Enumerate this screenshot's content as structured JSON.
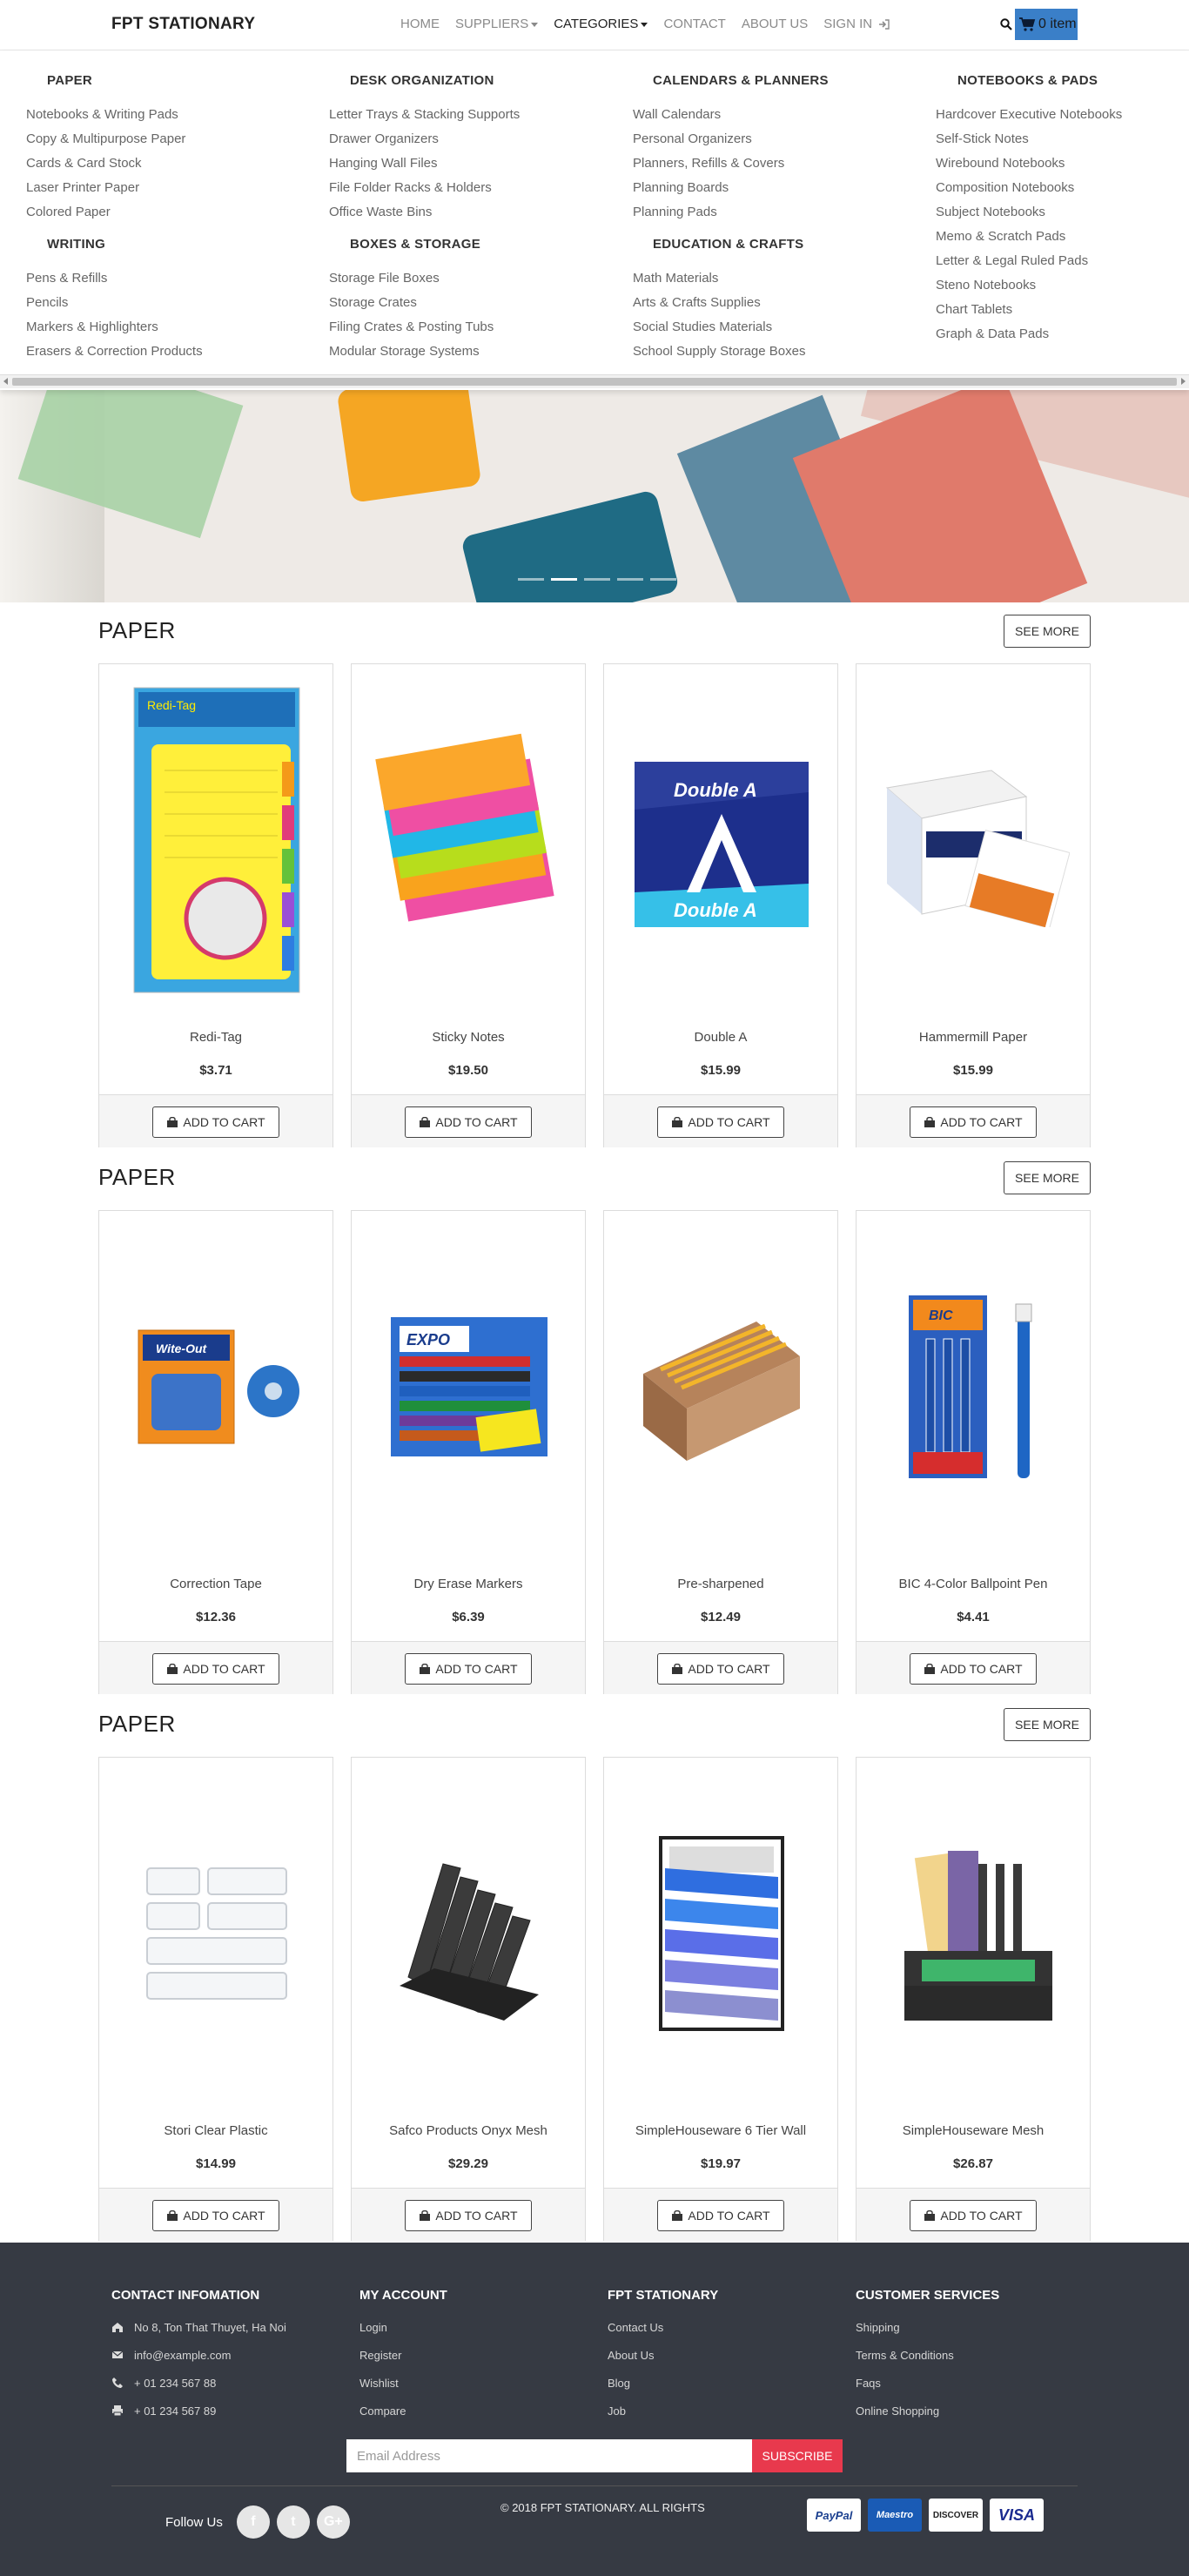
{
  "nav": {
    "brand": "FPT STATIONARY",
    "links": [
      "HOME",
      "SUPPLIERS",
      "CATEGORIES",
      "CONTACT",
      "ABOUT US",
      "SIGN IN"
    ],
    "cart_label": "0 item"
  },
  "mega": {
    "groups": [
      {
        "title": "PAPER",
        "items": [
          "Notebooks & Writing Pads",
          "Copy & Multipurpose Paper",
          "Cards & Card Stock",
          "Laser Printer Paper",
          "Colored Paper"
        ]
      },
      {
        "title": "DESK ORGANIZATION",
        "items": [
          "Letter Trays & Stacking Supports",
          "Drawer Organizers",
          "Hanging Wall Files",
          "File Folder Racks & Holders",
          "Office Waste Bins"
        ]
      },
      {
        "title": "CALENDARS & PLANNERS",
        "items": [
          "Wall Calendars",
          "Personal Organizers",
          "Planners, Refills & Covers",
          "Planning Boards",
          "Planning Pads"
        ]
      },
      {
        "title": "NOTEBOOKS & PADS",
        "items": [
          "Hardcover Executive Notebooks",
          "Self-Stick Notes",
          "Wirebound Notebooks",
          "Composition Notebooks",
          "Subject Notebooks",
          "Memo & Scratch Pads",
          "Letter & Legal Ruled Pads",
          "Steno Notebooks",
          "Chart Tablets",
          "Graph & Data Pads"
        ]
      },
      {
        "title": "WRITING",
        "items": [
          "Pens & Refills",
          "Pencils",
          "Markers & Highlighters",
          "Erasers & Correction Products"
        ]
      },
      {
        "title": "BOXES & STORAGE",
        "items": [
          "Storage File Boxes",
          "Storage Crates",
          "Filing Crates & Posting Tubs",
          "Modular Storage Systems"
        ]
      },
      {
        "title": "EDUCATION & CRAFTS",
        "items": [
          "Math Materials",
          "Arts & Crafts Supplies",
          "Social Studies Materials",
          "School Supply Storage Boxes"
        ]
      }
    ]
  },
  "sections": [
    {
      "title": "PAPER",
      "see_more": "SEE MORE",
      "products": [
        {
          "name": "Redi-Tag",
          "price": "$3.71",
          "icon": "redi-tag-icon"
        },
        {
          "name": "Sticky Notes",
          "price": "$19.50",
          "icon": "sticky-notes-icon"
        },
        {
          "name": "Double A",
          "price": "$15.99",
          "icon": "double-a-paper-icon"
        },
        {
          "name": "Hammermill Paper",
          "price": "$15.99",
          "icon": "hammermill-box-icon"
        }
      ]
    },
    {
      "title": "PAPER",
      "see_more": "SEE MORE",
      "products": [
        {
          "name": "Correction Tape",
          "price": "$12.36",
          "icon": "correction-tape-icon"
        },
        {
          "name": "Dry Erase Markers",
          "price": "$6.39",
          "icon": "markers-icon"
        },
        {
          "name": "Pre-sharpened",
          "price": "$12.49",
          "icon": "pencil-box-icon"
        },
        {
          "name": "BIC 4-Color Ballpoint Pen",
          "price": "$4.41",
          "icon": "ballpoint-pen-icon"
        }
      ]
    },
    {
      "title": "PAPER",
      "see_more": "SEE MORE",
      "products": [
        {
          "name": "Stori Clear Plastic",
          "price": "$14.99",
          "icon": "clear-organizer-icon"
        },
        {
          "name": "Safco Products Onyx Mesh",
          "price": "$29.29",
          "icon": "mesh-sorter-icon"
        },
        {
          "name": "SimpleHouseware 6 Tier Wall",
          "price": "$19.97",
          "icon": "wall-file-icon"
        },
        {
          "name": "SimpleHouseware Mesh",
          "price": "$26.87",
          "icon": "desk-organizer-icon"
        }
      ]
    }
  ],
  "add_to_cart": "ADD TO CART",
  "footer": {
    "contact": {
      "title": "CONTACT INFOMATION",
      "items": [
        "No 8, Ton That Thuyet, Ha Noi",
        "info@example.com",
        "+ 01 234 567 88",
        "+ 01 234 567 89"
      ]
    },
    "account": {
      "title": "MY ACCOUNT",
      "items": [
        "Login",
        "Register",
        "Wishlist",
        "Compare"
      ]
    },
    "company": {
      "title": "FPT STATIONARY",
      "items": [
        "Contact Us",
        "About Us",
        "Blog",
        "Job"
      ]
    },
    "service": {
      "title": "CUSTOMER SERVICES",
      "items": [
        "Shipping",
        "Terms & Conditions",
        "Faqs",
        "Online Shopping"
      ]
    },
    "email_placeholder": "Email Address",
    "subscribe": "SUBSCRIBE",
    "follow": "Follow Us",
    "social": [
      "f",
      "t",
      "G+"
    ],
    "copyright": "© 2018 FPT STATIONARY. ALL RIGHTS",
    "payments": [
      "PayPal",
      "Maestro",
      "DISCOVER",
      "VISA"
    ]
  },
  "colors": {
    "cart": "#3a7fc8",
    "subscribe": "#e8394d",
    "footer": "#363a43"
  }
}
